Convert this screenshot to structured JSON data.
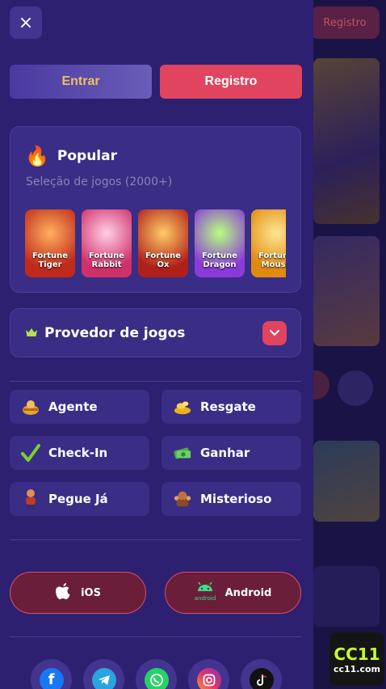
{
  "header": {
    "close_icon": "×"
  },
  "auth": {
    "login_label": "Entrar",
    "register_label": "Registro"
  },
  "popular": {
    "icon": "🔥",
    "title": "Popular",
    "subtitle": "Seleção de jogos (2000+)",
    "games": [
      {
        "title": "Fortune Tiger"
      },
      {
        "title": "Fortune Rabbit"
      },
      {
        "title": "Fortune Ox"
      },
      {
        "title": "Fortune Dragon"
      },
      {
        "title": "Fortune Mouse"
      }
    ]
  },
  "provider": {
    "label": "Provedor de jogos"
  },
  "menu": [
    {
      "label": "Agente",
      "icon": "agent-icon"
    },
    {
      "label": "Resgate",
      "icon": "gold-coins-icon"
    },
    {
      "label": "Check-In",
      "icon": "checkmark-icon"
    },
    {
      "label": "Ganhar",
      "icon": "money-icon"
    },
    {
      "label": "Pegue Já",
      "icon": "character-icon"
    },
    {
      "label": "Misterioso",
      "icon": "mystery-icon"
    }
  ],
  "apps": {
    "ios_label": "iOS",
    "android_label": "Android",
    "android_icon_text": "android"
  },
  "socials": [
    "facebook-icon",
    "telegram-icon",
    "whatsapp-icon",
    "instagram-icon",
    "tiktok-icon"
  ],
  "background": {
    "register_button": "Registro",
    "logo_main": "CC11",
    "logo_sub": "cc11.com"
  },
  "colors": {
    "accent_red": "#e0445e",
    "drawer_bg": "#2d2070",
    "card_bg": "#3a2d85",
    "gold": "#f0c060"
  }
}
